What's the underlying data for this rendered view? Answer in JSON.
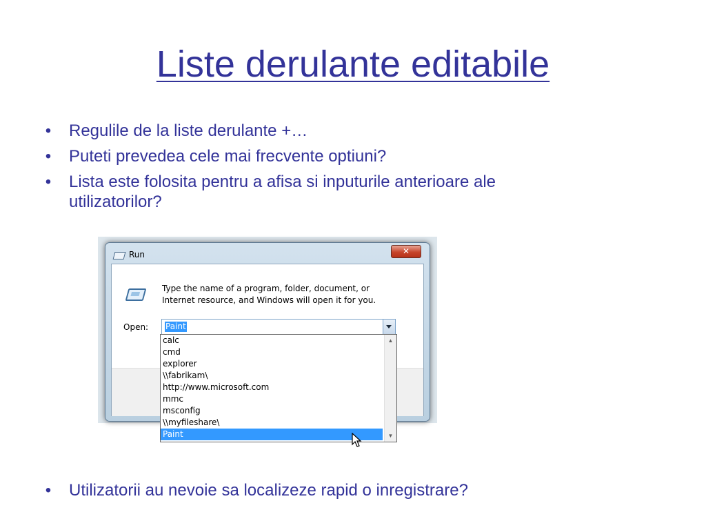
{
  "slide": {
    "title": "Liste derulante editabile",
    "bullets": [
      "Regulile de la liste derulante +…",
      "Puteti prevedea cele mai frecvente optiuni?",
      "Lista este folosita pentru a afisa si inputurile anterioare ale utilizatorilor?"
    ],
    "bottom_bullet": "Utilizatorii au nevoie sa localizeze rapid o inregistrare?",
    "bullet_glyph": "•",
    "title_color": "#333399"
  },
  "dialog": {
    "title": "Run",
    "close_glyph": "✕",
    "description": "Type the name of a program, folder, document, or Internet resource, and Windows will open it for you.",
    "open_label": "Open:",
    "combo_value": "Paint",
    "dropdown_items": [
      "calc",
      "cmd",
      "explorer",
      "\\\\fabrikam\\",
      "http://www.microsoft.com",
      "mmc",
      "msconfig",
      "\\\\myfileshare\\",
      "Paint"
    ],
    "selected_item": "Paint",
    "selection_color": "#3399ff",
    "icons": [
      "run-icon",
      "close-icon",
      "chevron-down-icon",
      "scroll-up-icon",
      "scroll-down-icon",
      "mouse-cursor-icon"
    ]
  }
}
